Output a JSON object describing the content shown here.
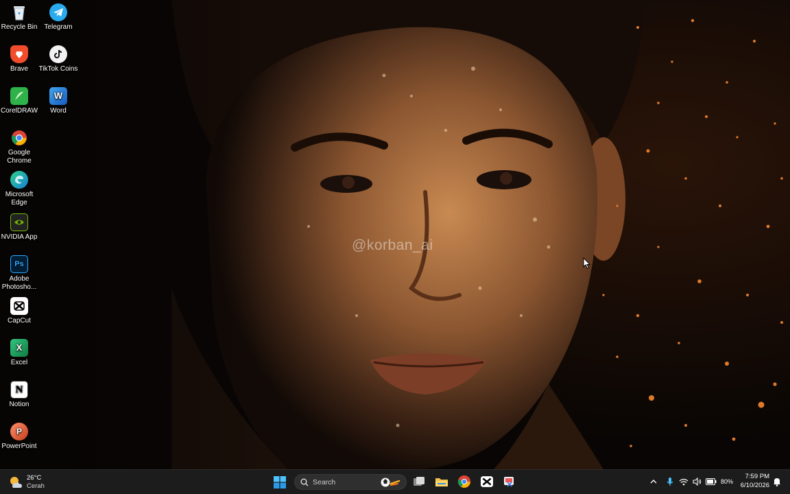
{
  "wallpaper": {
    "watermark": "@korban_ai"
  },
  "desktop_icons": [
    {
      "label": "Recycle Bin",
      "icon": "recycle-bin-icon"
    },
    {
      "label": "Telegram",
      "icon": "telegram-icon"
    },
    {
      "label": "Brave",
      "icon": "brave-icon"
    },
    {
      "label": "TikTok Coins",
      "icon": "tiktok-coins-icon"
    },
    {
      "label": "CorelDRAW",
      "icon": "coreldraw-icon"
    },
    {
      "label": "Word",
      "icon": "word-icon"
    },
    {
      "label": "Google Chrome",
      "icon": "chrome-icon"
    },
    {
      "label": "Microsoft Edge",
      "icon": "edge-icon"
    },
    {
      "label": "NVIDIA App",
      "icon": "nvidia-icon"
    },
    {
      "label": "Adobe Photosho...",
      "icon": "photoshop-icon"
    },
    {
      "label": "CapCut",
      "icon": "capcut-icon"
    },
    {
      "label": "Excel",
      "icon": "excel-icon"
    },
    {
      "label": "Notion",
      "icon": "notion-icon"
    },
    {
      "label": "PowerPoint",
      "icon": "powerpoint-icon"
    }
  ],
  "taskbar": {
    "weather": {
      "temperature": "26°C",
      "condition": "Cerah",
      "icon": "weather-sun-cloud-icon"
    },
    "search": {
      "placeholder": "Search"
    },
    "pinned": [
      "start-icon",
      "task-view-icon",
      "file-explorer-icon",
      "chrome-icon",
      "capcut-icon",
      "snipping-tool-icon"
    ],
    "tray": {
      "battery_percent": "80%",
      "time": "7:59 PM",
      "date": "6/10/2026",
      "icons": [
        "chevron-up-icon",
        "microphone-icon",
        "wifi-icon",
        "volume-icon",
        "battery-icon",
        "notification-icon"
      ]
    }
  },
  "colors": {
    "taskbar_bg": "#1c1c1c",
    "accent": "#4cc2ff",
    "skin_highlight": "#c8844a"
  }
}
